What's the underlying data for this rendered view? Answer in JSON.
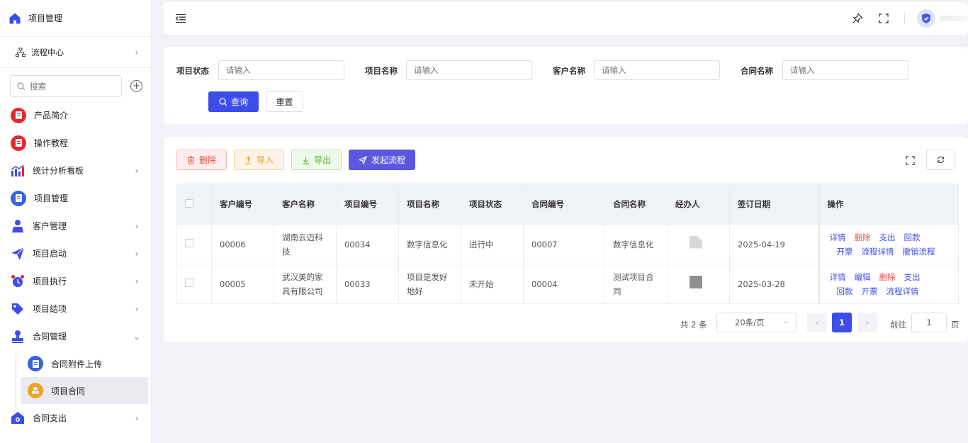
{
  "sidebar": {
    "header": "项目管理",
    "flow_center": "流程中心",
    "search_placeholder": "搜索",
    "items": [
      {
        "label": "产品简介"
      },
      {
        "label": "操作教程"
      },
      {
        "label": "统计分析看板"
      },
      {
        "label": "项目管理"
      },
      {
        "label": "客户管理"
      },
      {
        "label": "项目启动"
      },
      {
        "label": "项目执行"
      },
      {
        "label": "项目结项"
      },
      {
        "label": "合同管理"
      },
      {
        "label": "合同附件上传"
      },
      {
        "label": "项目合同"
      },
      {
        "label": "合同支出"
      }
    ]
  },
  "filter": {
    "fields": [
      {
        "label": "项目状态",
        "placeholder": "请输入"
      },
      {
        "label": "项目名称",
        "placeholder": "请输入"
      },
      {
        "label": "客户名称",
        "placeholder": "请输入"
      },
      {
        "label": "合同名称",
        "placeholder": "请输入"
      }
    ],
    "query": "查询",
    "reset": "重置"
  },
  "toolbar": {
    "delete": "删除",
    "import": "导入",
    "export": "导出",
    "start_flow": "发起流程"
  },
  "table": {
    "headers": [
      "客户编号",
      "客户名称",
      "项目编号",
      "项目名称",
      "项目状态",
      "合同编号",
      "合同名称",
      "经办人",
      "签订日期",
      "操作"
    ],
    "rows": [
      {
        "customer_no": "00006",
        "customer_name": "湖南云迈科技",
        "project_no": "00034",
        "project_name": "数字信息化",
        "status": "进行中",
        "contract_no": "00007",
        "contract_name": "数字信息化",
        "date": "2025-04-19",
        "ops1": [
          "详情",
          "删除",
          "支出",
          "回款"
        ],
        "ops2": [
          "开票",
          "流程详情",
          "撤销流程"
        ]
      },
      {
        "customer_no": "00005",
        "customer_name": "武汉美的家具有限公司",
        "project_no": "00033",
        "project_name": "项目是发好地好",
        "status": "未开始",
        "contract_no": "00004",
        "contract_name": "测试项目合同",
        "date": "2025-03-28",
        "ops1": [
          "详情",
          "编辑",
          "删除",
          "支出"
        ],
        "ops2": [
          "回款",
          "开票",
          "流程详情"
        ]
      }
    ]
  },
  "pagination": {
    "total": "共 2 条",
    "page_size": "20条/页",
    "current": "1",
    "goto_label": "前往",
    "goto_value": "1",
    "page_suffix": "页"
  }
}
